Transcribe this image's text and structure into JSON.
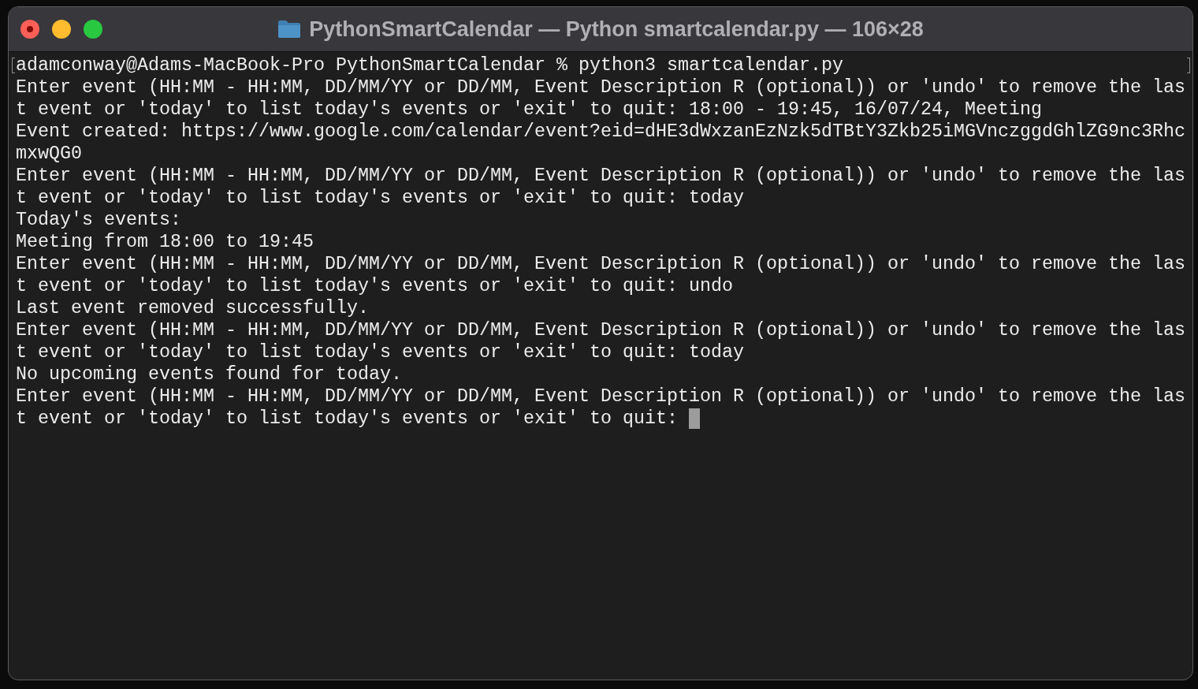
{
  "window": {
    "title": "PythonSmartCalendar — Python smartcalendar.py — 106×28"
  },
  "terminal": {
    "lines": [
      {
        "text": "adamconway@Adams-MacBook-Pro PythonSmartCalendar % python3 smartcalendar.py",
        "marked": true,
        "cursor": false
      },
      {
        "text": "Enter event (HH:MM - HH:MM, DD/MM/YY or DD/MM, Event Description R (optional)) or 'undo' to remove the las",
        "marked": false,
        "cursor": false
      },
      {
        "text": "t event or 'today' to list today's events or 'exit' to quit: 18:00 - 19:45, 16/07/24, Meeting",
        "marked": false,
        "cursor": false
      },
      {
        "text": "Event created: https://www.google.com/calendar/event?eid=dHE3dWxzanEzNzk5dTBtY3Zkb25iMGVnczggdGhlZG9nc3Rhc",
        "marked": false,
        "cursor": false
      },
      {
        "text": "mxwQG0",
        "marked": false,
        "cursor": false
      },
      {
        "text": "Enter event (HH:MM - HH:MM, DD/MM/YY or DD/MM, Event Description R (optional)) or 'undo' to remove the las",
        "marked": false,
        "cursor": false
      },
      {
        "text": "t event or 'today' to list today's events or 'exit' to quit: today",
        "marked": false,
        "cursor": false
      },
      {
        "text": "Today's events:",
        "marked": false,
        "cursor": false
      },
      {
        "text": "Meeting from 18:00 to 19:45",
        "marked": false,
        "cursor": false
      },
      {
        "text": "Enter event (HH:MM - HH:MM, DD/MM/YY or DD/MM, Event Description R (optional)) or 'undo' to remove the las",
        "marked": false,
        "cursor": false
      },
      {
        "text": "t event or 'today' to list today's events or 'exit' to quit: undo",
        "marked": false,
        "cursor": false
      },
      {
        "text": "Last event removed successfully.",
        "marked": false,
        "cursor": false
      },
      {
        "text": "Enter event (HH:MM - HH:MM, DD/MM/YY or DD/MM, Event Description R (optional)) or 'undo' to remove the las",
        "marked": false,
        "cursor": false
      },
      {
        "text": "t event or 'today' to list today's events or 'exit' to quit: today",
        "marked": false,
        "cursor": false
      },
      {
        "text": "No upcoming events found for today.",
        "marked": false,
        "cursor": false
      },
      {
        "text": "Enter event (HH:MM - HH:MM, DD/MM/YY or DD/MM, Event Description R (optional)) or 'undo' to remove the las",
        "marked": false,
        "cursor": false
      },
      {
        "text": "t event or 'today' to list today's events or 'exit' to quit:",
        "marked": false,
        "cursor": true
      }
    ]
  }
}
